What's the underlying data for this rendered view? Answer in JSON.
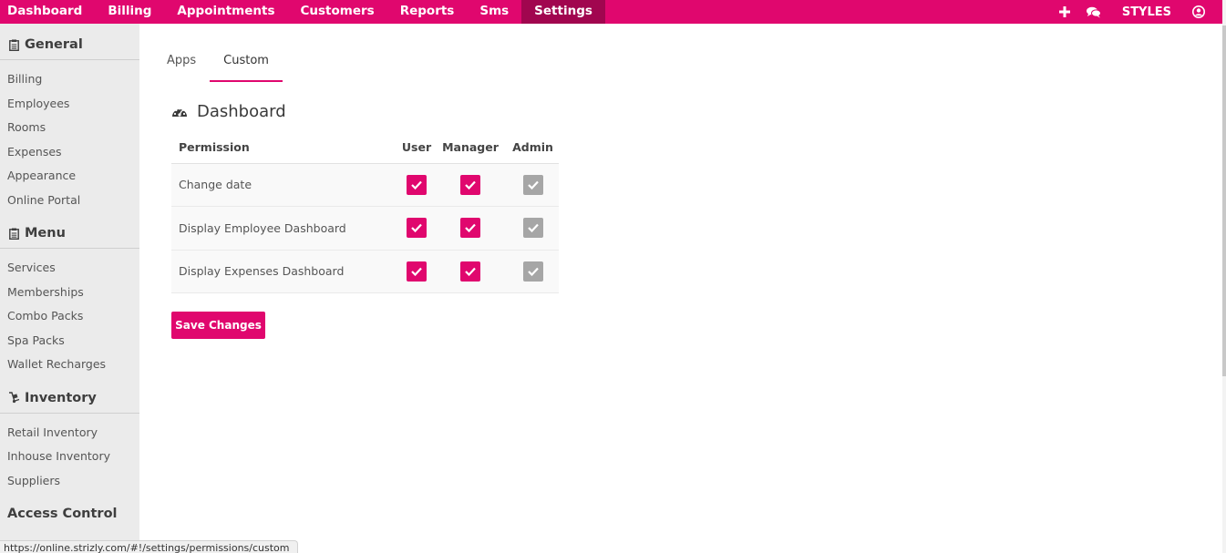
{
  "nav": {
    "items": [
      "Dashboard",
      "Billing",
      "Appointments",
      "Customers",
      "Reports",
      "Sms",
      "Settings"
    ],
    "active": "Settings",
    "right": {
      "add_icon": "plus-icon",
      "chat_icon": "comments-icon",
      "styles_label": "STYLES",
      "user_icon": "user-circle-icon"
    }
  },
  "sidebar": {
    "general": {
      "title": "General",
      "icon": "clipboard-icon",
      "items": [
        "Billing",
        "Employees",
        "Rooms",
        "Expenses",
        "Appearance",
        "Online Portal"
      ]
    },
    "menu": {
      "title": "Menu",
      "icon": "clipboard-icon",
      "items": [
        "Services",
        "Memberships",
        "Combo Packs",
        "Spa Packs",
        "Wallet Recharges"
      ]
    },
    "inventory": {
      "title": "Inventory",
      "icon": "dolly-icon",
      "items": [
        "Retail Inventory",
        "Inhouse Inventory",
        "Suppliers"
      ]
    },
    "access_control": {
      "title": "Access Control"
    }
  },
  "tabs": [
    "Apps",
    "Custom"
  ],
  "active_tab": "Custom",
  "panel": {
    "title": "Dashboard",
    "icon": "dashboard-gauge-icon",
    "columns": [
      "Permission",
      "User",
      "Manager",
      "Admin"
    ],
    "rows": [
      {
        "label": "Change date",
        "user": true,
        "manager": true,
        "admin": true
      },
      {
        "label": "Display Employee Dashboard",
        "user": true,
        "manager": true,
        "admin": true
      },
      {
        "label": "Display Expenses Dashboard",
        "user": true,
        "manager": true,
        "admin": true
      }
    ],
    "admin_disabled": true
  },
  "save_label": "Save Changes",
  "status_url": "https://online.strizly.com/#!/settings/permissions/custom",
  "colors": {
    "brand": "#e0076e",
    "brand_dark": "#a1064f",
    "disabled": "#a6a6a6",
    "sidebar_bg": "#ebebeb"
  }
}
